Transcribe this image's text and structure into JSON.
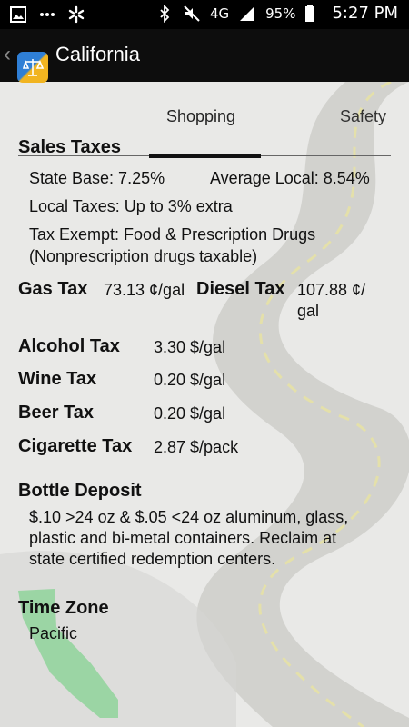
{
  "status_bar": {
    "battery": "95%",
    "time": "5:27 PM",
    "network": "4G",
    "icons": [
      "gallery-icon",
      "dots-icon",
      "walmart-spark-icon",
      "bluetooth-icon",
      "mute-icon",
      "signal-icon",
      "battery-icon"
    ]
  },
  "app_bar": {
    "title": "California",
    "back_glyph": "‹"
  },
  "tabs": [
    {
      "label": "Shopping",
      "selected": true
    },
    {
      "label": "Safety",
      "selected": false
    }
  ],
  "sales_taxes": {
    "heading": "Sales Taxes",
    "state_base": "State Base: 7.25%",
    "average_local": "Average Local: 8.54%",
    "local_taxes": "Local Taxes: Up to 3% extra",
    "tax_exempt_line1": "Tax Exempt: Food & Prescription Drugs",
    "tax_exempt_line2": "(Nonprescription drugs taxable)"
  },
  "fuel": {
    "gas_label": "Gas Tax",
    "gas_value": "73.13 ¢/gal",
    "diesel_label": "Diesel Tax",
    "diesel_value_line1": "107.88 ¢/",
    "diesel_value_line2": "gal"
  },
  "excise": [
    {
      "label": "Alcohol Tax",
      "value": "3.30 $/gal"
    },
    {
      "label": "Wine Tax",
      "value": "0.20 $/gal"
    },
    {
      "label": "Beer Tax",
      "value": "0.20 $/gal"
    },
    {
      "label": "Cigarette Tax",
      "value": "2.87 $/pack"
    }
  ],
  "bottle_deposit": {
    "heading": "Bottle Deposit",
    "line1": "$.10 >24 oz & $.05 <24 oz aluminum, glass,",
    "line2": "plastic and bi-metal containers.  Reclaim at",
    "line3": "state certified redemption centers."
  },
  "time_zone": {
    "heading": "Time Zone",
    "value": "Pacific"
  },
  "colors": {
    "background": "#e9e9e7",
    "app_bar": "#0d0d0d",
    "road": "#c9c9c6",
    "road_line": "#e6e1a6",
    "state_map": "#8fd49a"
  }
}
